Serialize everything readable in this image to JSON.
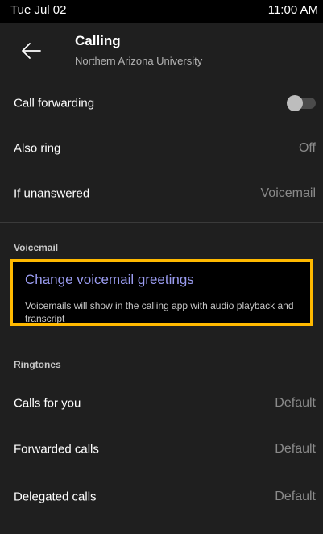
{
  "status_bar": {
    "date": "Tue Jul 02",
    "time": "11:00 AM"
  },
  "header": {
    "title": "Calling",
    "subtitle": "Northern Arizona University",
    "back_icon": "arrow-left-icon"
  },
  "settings": {
    "call_forwarding": {
      "label": "Call forwarding",
      "toggle_on": false
    },
    "also_ring": {
      "label": "Also ring",
      "value": "Off"
    },
    "if_unanswered": {
      "label": "If unanswered",
      "value": "Voicemail"
    }
  },
  "voicemail": {
    "section_label": "Voicemail",
    "change_greetings_label": "Change voicemail greetings",
    "description": "Voicemails will show in the calling app with audio playback and transcript"
  },
  "ringtones": {
    "section_label": "Ringtones",
    "items": [
      {
        "label": "Calls for you",
        "value": "Default"
      },
      {
        "label": "Forwarded calls",
        "value": "Default"
      },
      {
        "label": "Delegated calls",
        "value": "Default"
      }
    ]
  },
  "colors": {
    "background": "#1f1f1f",
    "status_bar": "#000000",
    "accent_link": "#9a9cf0",
    "highlight_border": "#ffb900",
    "secondary_text": "#8a8a8a"
  }
}
